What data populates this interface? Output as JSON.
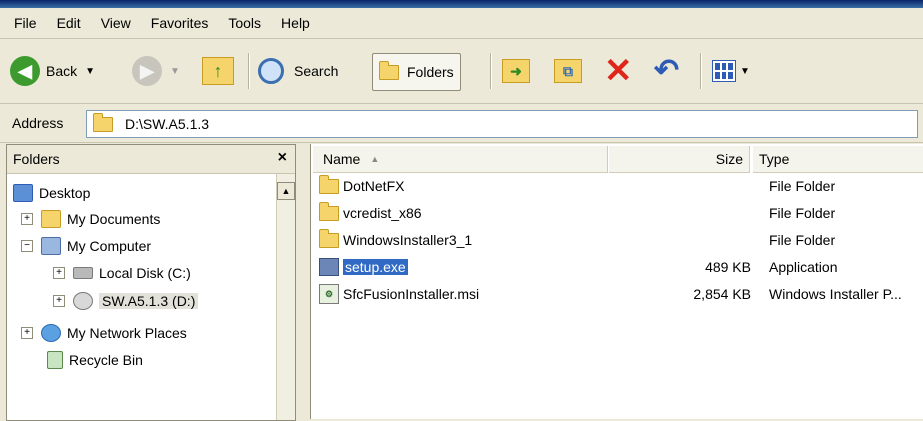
{
  "menu": [
    "File",
    "Edit",
    "View",
    "Favorites",
    "Tools",
    "Help"
  ],
  "toolbar": {
    "back_label": "Back",
    "search_label": "Search",
    "folders_label": "Folders"
  },
  "address": {
    "label": "Address",
    "value": "D:\\SW.A5.1.3"
  },
  "folders_pane": {
    "title": "Folders",
    "close": "×",
    "tree": [
      {
        "label": "Desktop",
        "icon": "desktop-icon"
      },
      {
        "label": "My Documents",
        "icon": "folder-icon",
        "expander": "+"
      },
      {
        "label": "My Computer",
        "icon": "computer-icon",
        "expander": "−"
      },
      {
        "label": "Local Disk (C:)",
        "icon": "disk-icon",
        "expander": "+"
      },
      {
        "label": "SW.A5.1.3 (D:)",
        "icon": "cd-drive-icon",
        "expander": "+"
      },
      {
        "label": "My Network Places",
        "icon": "network-icon",
        "expander": "+"
      },
      {
        "label": "Recycle Bin",
        "icon": "recycle-bin-icon"
      }
    ]
  },
  "file_list": {
    "columns": {
      "name": "Name",
      "size": "Size",
      "type": "Type"
    },
    "rows": [
      {
        "name": "DotNetFX",
        "size": "",
        "type": "File Folder",
        "icon": "folder-icon"
      },
      {
        "name": "vcredist_x86",
        "size": "",
        "type": "File Folder",
        "icon": "folder-icon"
      },
      {
        "name": "WindowsInstaller3_1",
        "size": "",
        "type": "File Folder",
        "icon": "folder-icon"
      },
      {
        "name": "setup.exe",
        "size": "489 KB",
        "type": "Application",
        "icon": "exe-icon",
        "selected": true
      },
      {
        "name": "SfcFusionInstaller.msi",
        "size": "2,854 KB",
        "type": "Windows Installer P...",
        "icon": "msi-icon"
      }
    ]
  },
  "colors": {
    "selection": "#316ac5",
    "chrome": "#ece9d8"
  }
}
